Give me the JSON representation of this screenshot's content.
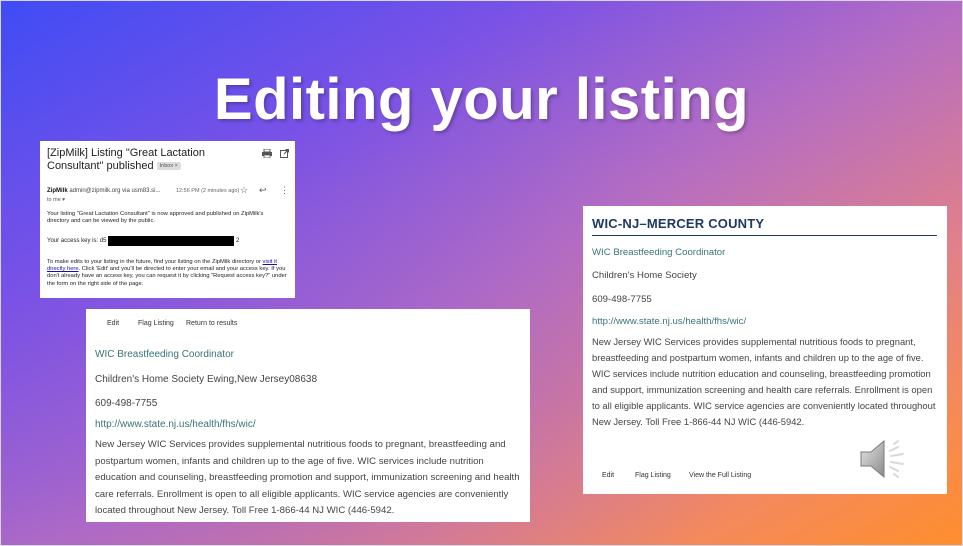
{
  "slide": {
    "title": "Editing your listing"
  },
  "email": {
    "subject": "[ZipMilk] Listing \"Great Lactation Consultant\" published",
    "inbox_chip": "Inbox ×",
    "sender_name": "ZipMilk",
    "sender_addr": "admin@zipmilk.org via usm83.si...",
    "time": "12:56 PM (2 minutes ago)",
    "to": "to me ▾",
    "para1": "Your listing \"Great Lactation Consultant\" is now approved and published on ZipMilk's directory and can be viewed by the public.",
    "key_label": "Your access key is: d5",
    "key_tail": "2",
    "para3_a": "To make edits to your listing in the future, find your listing on the ZipMilk directory or ",
    "para3_link": "visit it directly here",
    "para3_b": ". Click 'Edit' and you'll be directed to enter your email and your access key. If you don't already have an access key, you can request it by clicking \"Request access key?\" under the form on the right side of the page."
  },
  "listing_left": {
    "toolbar": [
      "Edit",
      "Flag Listing",
      "Return to results"
    ],
    "title": "WIC Breastfeeding Coordinator",
    "org": "Children's Home Society Ewing,New Jersey08638",
    "phone": "609-498-7755",
    "url": "http://www.state.nj.us/health/fhs/wic/",
    "description": "New Jersey WIC Services provides supplemental nutritious foods to pregnant, breastfeeding and postpartum women, infants and children up to the age of five. WIC services include nutrition education and counseling, breastfeeding promotion and support, immunization screening and health care referrals. Enrollment is open to all eligible applicants. WIC service agencies are conveniently located throughout New Jersey. Toll Free 1-866-44 NJ WIC (446-5942."
  },
  "listing_right": {
    "county": "WIC-NJ–MERCER COUNTY",
    "title": "WIC Breastfeeding Coordinator",
    "org": "Children's Home Society",
    "phone": "609-498-7755",
    "url": "http://www.state.nj.us/health/fhs/wic/",
    "description": "New Jersey WIC Services provides supplemental nutritious foods to pregnant, breastfeeding and postpartum women, infants and children up to the age of five. WIC services include nutrition education and counseling, breastfeeding promotion and support, immunization screening and health care referrals. Enrollment is open to all eligible applicants. WIC service agencies are conveniently located throughout New Jersey. Toll Free 1-866-44 NJ WIC (446-5942.",
    "toolbar": [
      "Edit",
      "Flag Listing",
      "View the Full Listing"
    ]
  },
  "icons": {
    "speaker": "speaker-icon",
    "print": "print-icon",
    "open": "open-in-new-icon",
    "star": "star-icon",
    "reply": "reply-icon",
    "more": "more-vert-icon"
  },
  "colors": {
    "heading_navy": "#1f3864",
    "link_teal": "#3a7377",
    "gradient_start": "#3f4cf5",
    "gradient_end": "#ff8e2c"
  }
}
